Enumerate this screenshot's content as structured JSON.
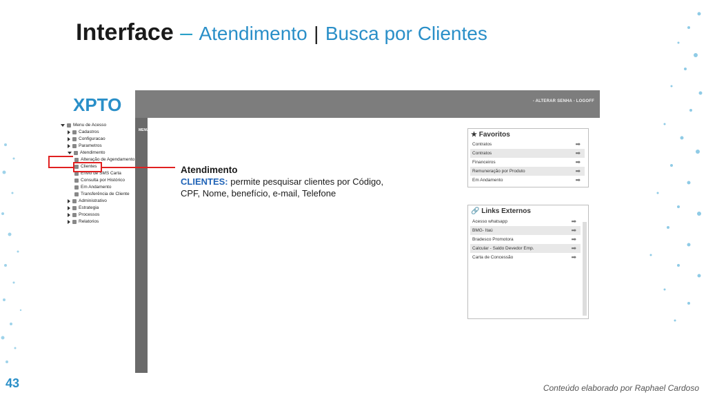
{
  "slide": {
    "title_bold": "Interface",
    "title_dash": "–",
    "title_part1": "Atendimento",
    "title_sep": "|",
    "title_part2": "Busca por Clientes",
    "page_number": "43",
    "footer": "Conteúdo elaborado por Raphael Cardoso"
  },
  "app": {
    "logo_text": "XPTO",
    "topbar_links": "- ALTERAR SENHA - LOGOFF",
    "menu_label": "MENU",
    "tree": [
      {
        "label": "Menu de Acesso",
        "level": 0,
        "arrow": "down"
      },
      {
        "label": "Cadastros",
        "level": 1,
        "arrow": "right"
      },
      {
        "label": "Configuracao",
        "level": 1,
        "arrow": "right"
      },
      {
        "label": "Parametros",
        "level": 1,
        "arrow": "right"
      },
      {
        "label": "Atendimento",
        "level": 1,
        "arrow": "down"
      },
      {
        "label": "Alteração de Agendamento",
        "level": 2,
        "arrow": ""
      },
      {
        "label": "Clientes",
        "level": 2,
        "arrow": ""
      },
      {
        "label": "Envio de SMS Carta",
        "level": 2,
        "arrow": ""
      },
      {
        "label": "Consulta por Histórico",
        "level": 2,
        "arrow": ""
      },
      {
        "label": "Em Andamento",
        "level": 2,
        "arrow": ""
      },
      {
        "label": "Transferência de Cliente",
        "level": 2,
        "arrow": ""
      },
      {
        "label": "Administrativo",
        "level": 1,
        "arrow": "right"
      },
      {
        "label": "Estrategia",
        "level": 1,
        "arrow": "right"
      },
      {
        "label": "Processos",
        "level": 1,
        "arrow": "right"
      },
      {
        "label": "Relatorios",
        "level": 1,
        "arrow": "right"
      }
    ],
    "favoritos": {
      "title": "Favoritos",
      "items": [
        "Contratos",
        "Contratos",
        "Financeiros",
        "Remuneração por Produto",
        "Em Andamento"
      ]
    },
    "links_externos": {
      "title": "Links Externos",
      "items": [
        "Acesso whatsapp",
        "BMG- Itaú",
        "Bradesco Promotora",
        "Calcular - Saldo Devedor Emp.",
        "Carta de Concessão"
      ]
    }
  },
  "annotation": {
    "heading": "Atendimento",
    "keyword": "CLIENTES:",
    "text": "permite pesquisar clientes por Código, CPF, Nome, benefício, e-mail, Telefone"
  },
  "colors": {
    "accent": "#2a8fc8",
    "highlight": "#e02020",
    "topbar": "#7d7d7d"
  }
}
